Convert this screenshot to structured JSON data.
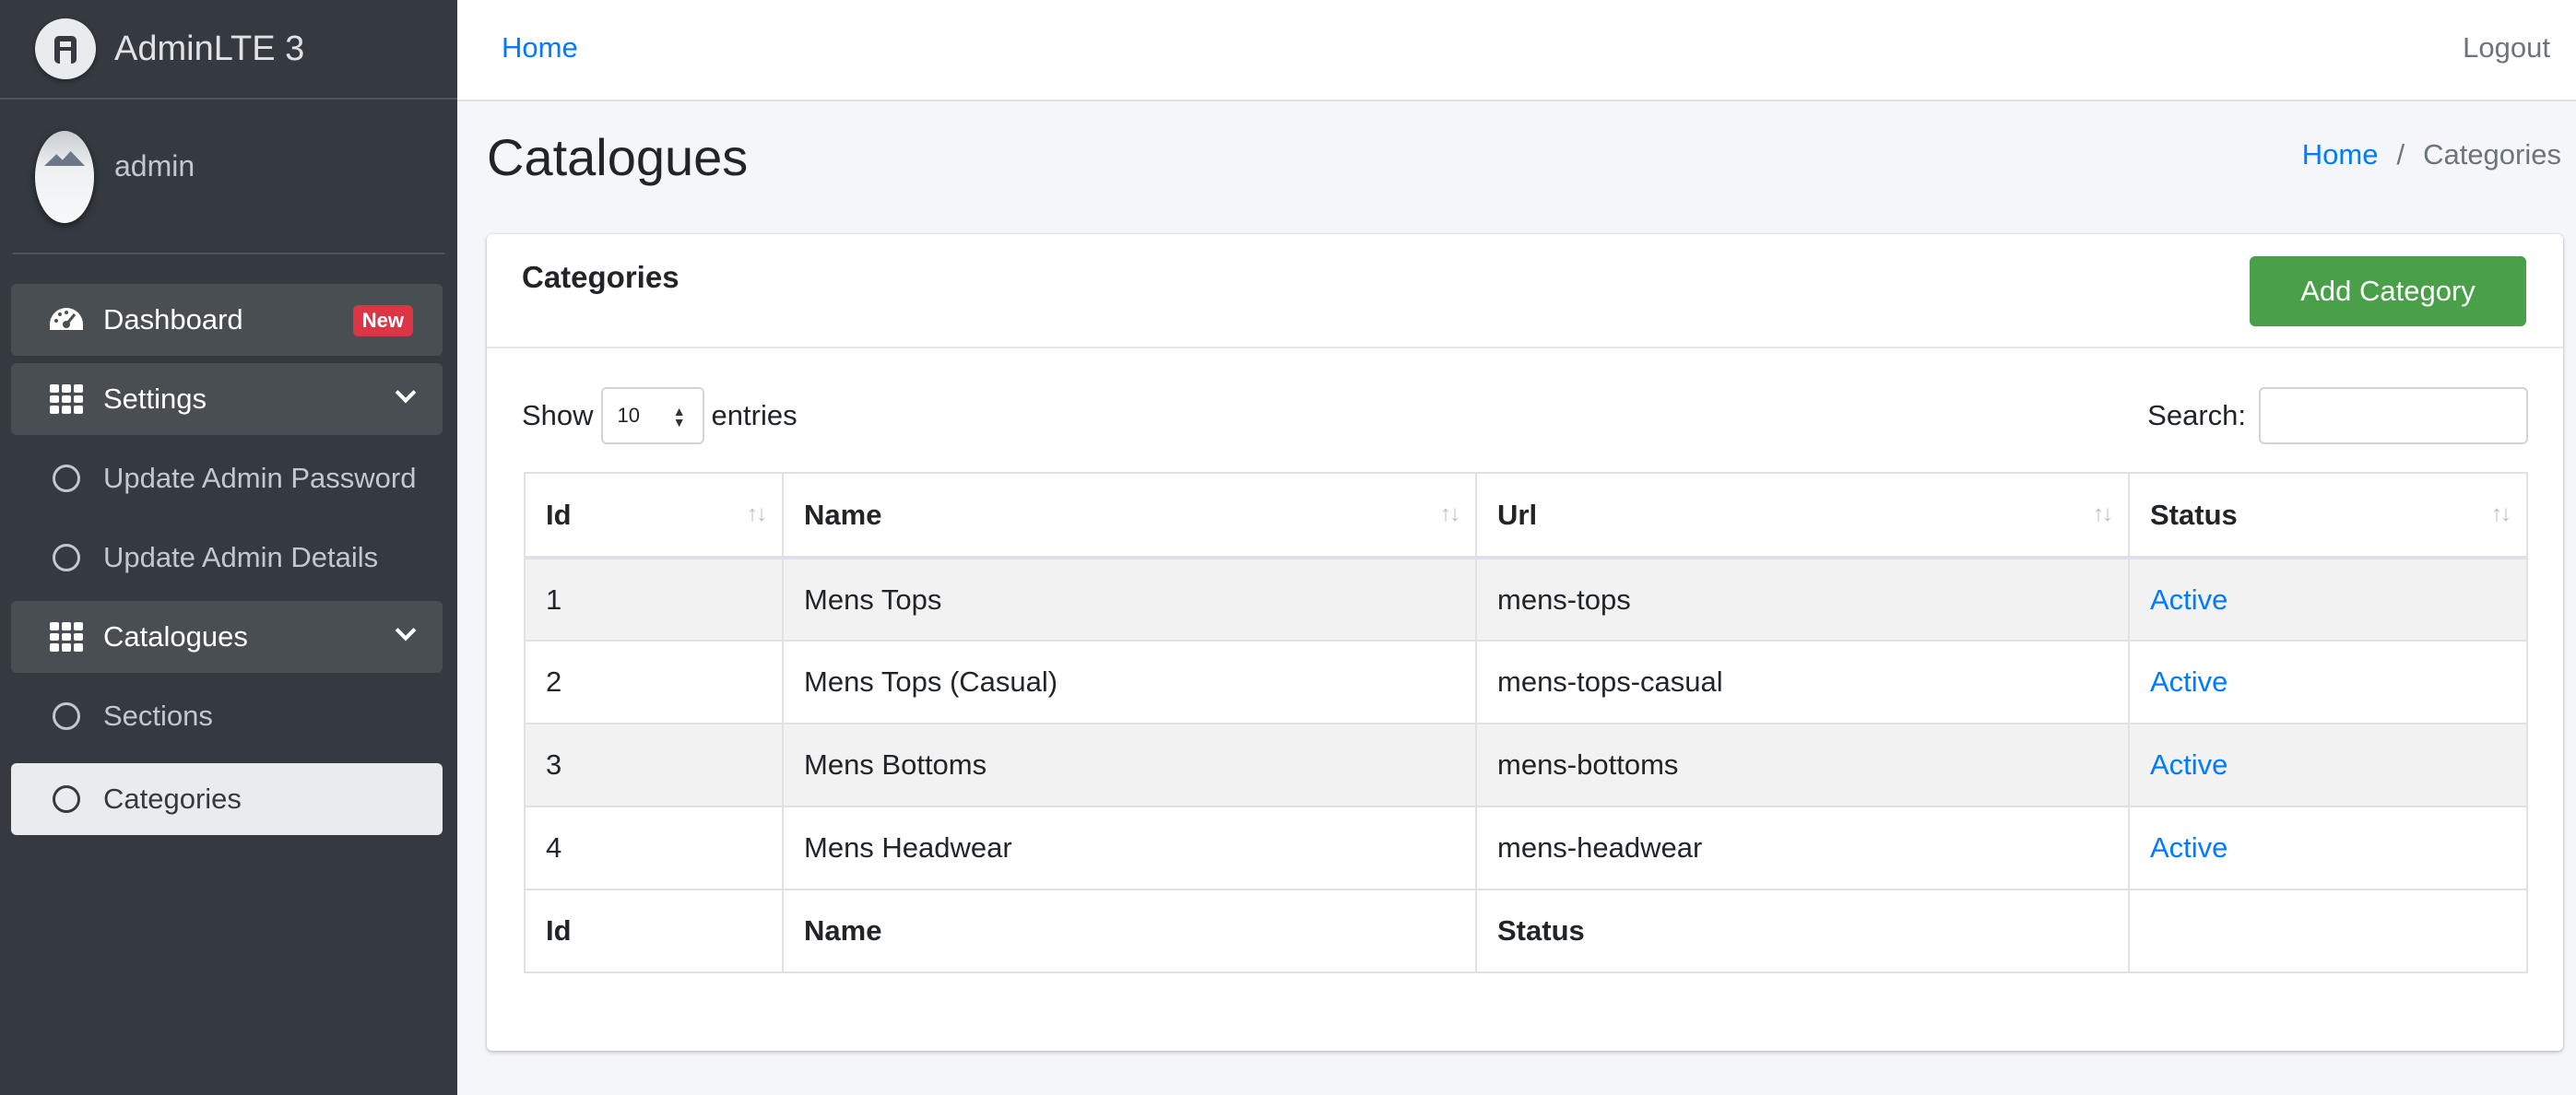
{
  "brand": {
    "title": "AdminLTE 3"
  },
  "user": {
    "name": "admin"
  },
  "sidebar": {
    "items": [
      {
        "label": "Dashboard",
        "badge": "New"
      },
      {
        "label": "Settings"
      },
      {
        "label": "Update Admin Password"
      },
      {
        "label": "Update Admin Details"
      },
      {
        "label": "Catalogues"
      },
      {
        "label": "Sections"
      },
      {
        "label": "Categories"
      }
    ]
  },
  "topbar": {
    "home": "Home",
    "logout": "Logout"
  },
  "page": {
    "title": "Catalogues",
    "breadcrumb": {
      "home": "Home",
      "separator": "/",
      "current": "Categories"
    }
  },
  "card": {
    "title": "Categories",
    "add_button": "Add Category",
    "show_label": "Show",
    "entries_value": "10",
    "entries_label": "entries",
    "search_label": "Search:"
  },
  "table": {
    "headers": [
      "Id",
      "Name",
      "Url",
      "Status"
    ],
    "rows": [
      {
        "id": "1",
        "name": "Mens Tops",
        "url": "mens-tops",
        "status": "Active"
      },
      {
        "id": "2",
        "name": "Mens Tops (Casual)",
        "url": "mens-tops-casual",
        "status": "Active"
      },
      {
        "id": "3",
        "name": "Mens Bottoms",
        "url": "mens-bottoms",
        "status": "Active"
      },
      {
        "id": "4",
        "name": "Mens Headwear",
        "url": "mens-headwear",
        "status": "Active"
      }
    ],
    "footer": [
      "Id",
      "Name",
      "Status"
    ]
  },
  "colors": {
    "primary": "#007bff",
    "success": "#4a9f49",
    "danger": "#dc3545",
    "sidebar": "#343a40"
  }
}
